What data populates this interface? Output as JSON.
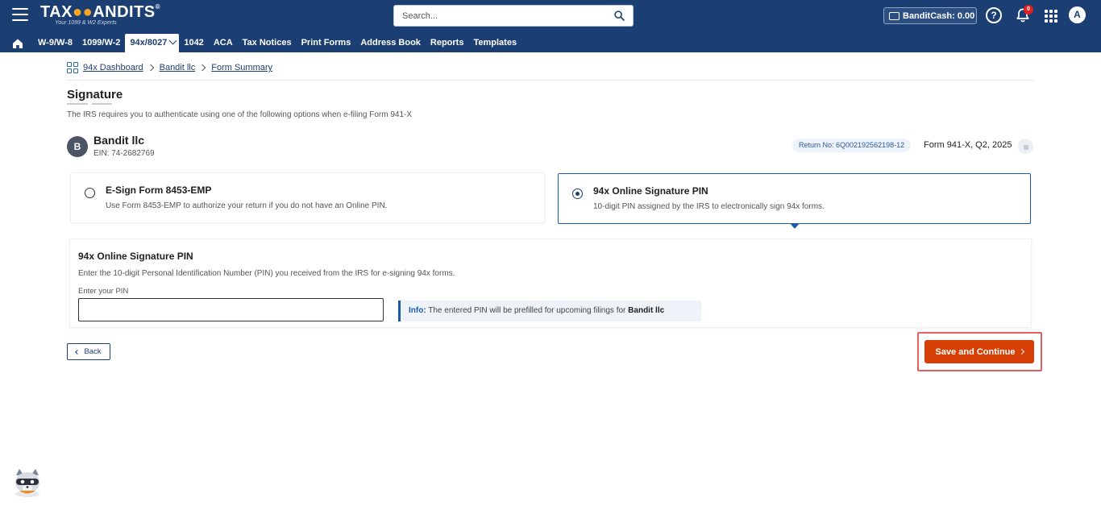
{
  "header": {
    "logo_text_left": "TAX",
    "logo_text_right": "ANDITS",
    "logo_reg": "®",
    "logo_tagline": "Your 1099 & W2 Experts",
    "search_placeholder": "Search...",
    "bandit_cash_label": "BanditCash: 0.00",
    "help_glyph": "?",
    "notification_count": "0",
    "user_initial": "A"
  },
  "nav": {
    "items": [
      "W-9/W-8",
      "1099/W-2",
      "94x/8027",
      "1042",
      "ACA",
      "Tax Notices",
      "Print Forms",
      "Address Book",
      "Reports",
      "Templates"
    ],
    "active": "94x/8027"
  },
  "breadcrumb": {
    "items": [
      "94x Dashboard",
      "Bandit llc",
      "Form Summary"
    ]
  },
  "page": {
    "title": "Signature",
    "subtitle": "The IRS requires you to authenticate using one of the following options when e-filing Form 941-X"
  },
  "business": {
    "initial": "B",
    "name": "Bandit llc",
    "ein": "EIN: 74-2682769",
    "return_no": "Return No: 6Q002192562198-12",
    "form": "Form 941-X, Q2, 2025"
  },
  "options": [
    {
      "title": "E-Sign Form 8453-EMP",
      "desc": "Use Form 8453-EMP to authorize your return if you do not have an Online PIN.",
      "selected": false
    },
    {
      "title": "94x Online Signature PIN",
      "desc": "10-digit PIN assigned by the IRS to electronically sign 94x forms.",
      "selected": true
    }
  ],
  "pin": {
    "title": "94x Online Signature PIN",
    "desc": "Enter the 10-digit Personal Identification Number (PIN) you received from the IRS for e-signing 94x forms.",
    "label": "Enter your PIN",
    "value": "",
    "info_label": "Info:",
    "info_text": "The entered PIN will be prefilled for upcoming filings for",
    "info_business": "Bandit llc"
  },
  "actions": {
    "back": "Back",
    "save": "Save and Continue"
  },
  "colors": {
    "header_bg": "#1c3f73",
    "accent": "#1c5aa8",
    "save_button": "#d64006",
    "highlight_border": "#e26060"
  }
}
